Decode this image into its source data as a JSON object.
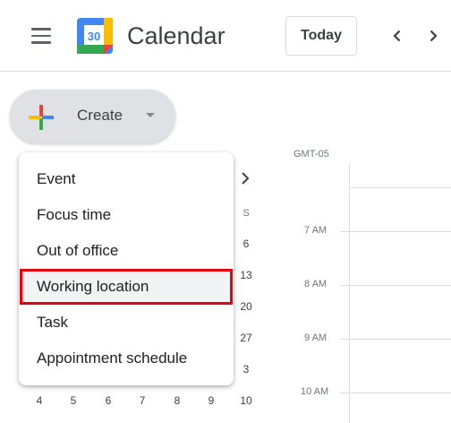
{
  "header": {
    "app_title": "Calendar",
    "logo_day": "30",
    "today_label": "Today",
    "menu_icon": "hamburger-menu-icon",
    "prev_icon": "chevron-left-icon",
    "next_icon": "chevron-right-icon"
  },
  "create": {
    "label": "Create",
    "icon": "plus-icon",
    "caret_icon": "caret-down-icon"
  },
  "create_menu": {
    "items": [
      {
        "label": "Event"
      },
      {
        "label": "Focus time"
      },
      {
        "label": "Out of office"
      },
      {
        "label": "Working location"
      },
      {
        "label": "Task"
      },
      {
        "label": "Appointment schedule"
      }
    ],
    "highlighted_index": 3
  },
  "mini_calendar": {
    "next_month_icon": "chevron-right-icon",
    "day_of_week": "S",
    "visible_right_column": [
      "6",
      "13",
      "20",
      "27",
      "3"
    ],
    "last_row": [
      "4",
      "5",
      "6",
      "7",
      "8",
      "9",
      "10"
    ]
  },
  "day_view": {
    "timezone": "GMT-05",
    "hours": [
      "7 AM",
      "8 AM",
      "9 AM",
      "10 AM"
    ]
  },
  "colors": {
    "highlight_outline": "#e8000b",
    "create_bg": "#dfe1e5",
    "logo_blue": "#4285f4",
    "logo_green": "#34a853",
    "logo_yellow": "#fbbc04",
    "logo_red": "#ea4335"
  }
}
